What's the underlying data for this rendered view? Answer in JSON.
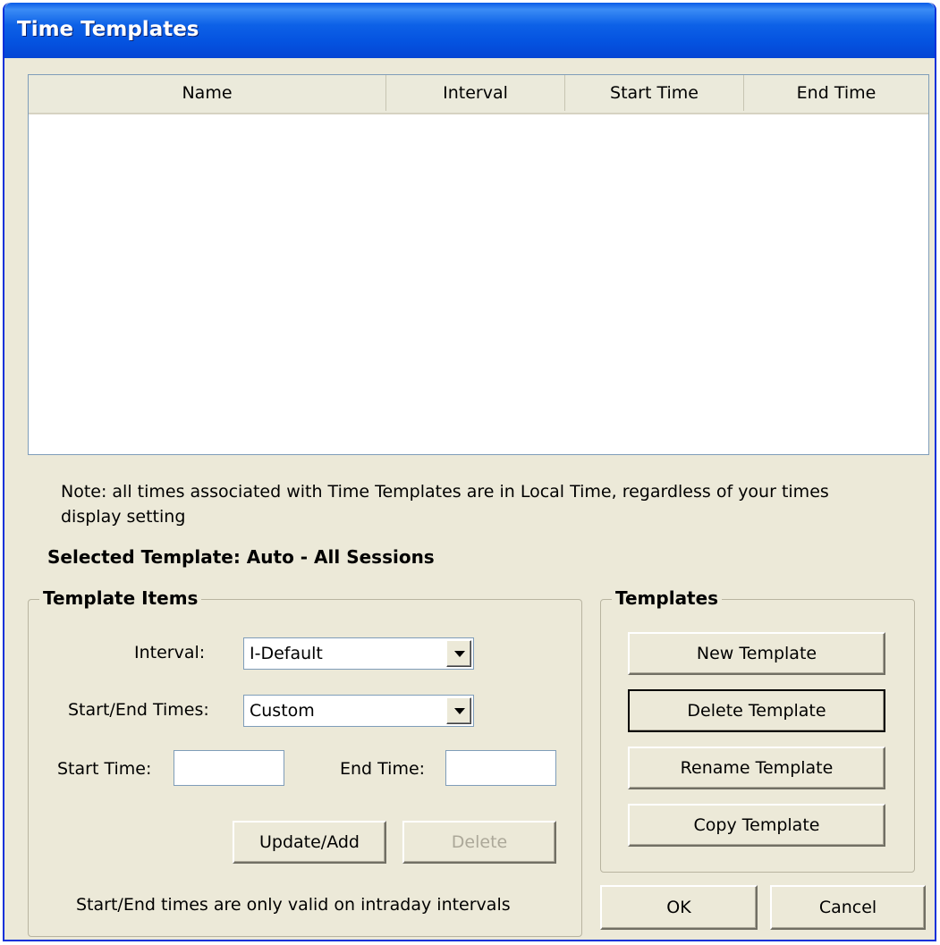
{
  "window": {
    "title": "Time Templates"
  },
  "list": {
    "columns": [
      "Name",
      "Interval",
      "Start Time",
      "End Time"
    ],
    "rows": []
  },
  "note": "Note: all times associated with Time Templates are in Local Time, regardless of your times display setting",
  "selected_template": "Selected Template: Auto - All Sessions",
  "template_items": {
    "title": "Template Items",
    "interval_label": "Interval:",
    "interval_value": "I-Default",
    "start_end_label": "Start/End Times:",
    "start_end_value": "Custom",
    "start_time_label": "Start Time:",
    "start_time_value": "",
    "end_time_label": "End Time:",
    "end_time_value": "",
    "update_add_label": "Update/Add",
    "delete_label": "Delete",
    "footnote": "Start/End times are only valid on intraday intervals"
  },
  "templates": {
    "title": "Templates",
    "new_label": "New Template",
    "delete_label": "Delete Template",
    "rename_label": "Rename Template",
    "copy_label": "Copy Template"
  },
  "dialog": {
    "ok_label": "OK",
    "cancel_label": "Cancel"
  }
}
